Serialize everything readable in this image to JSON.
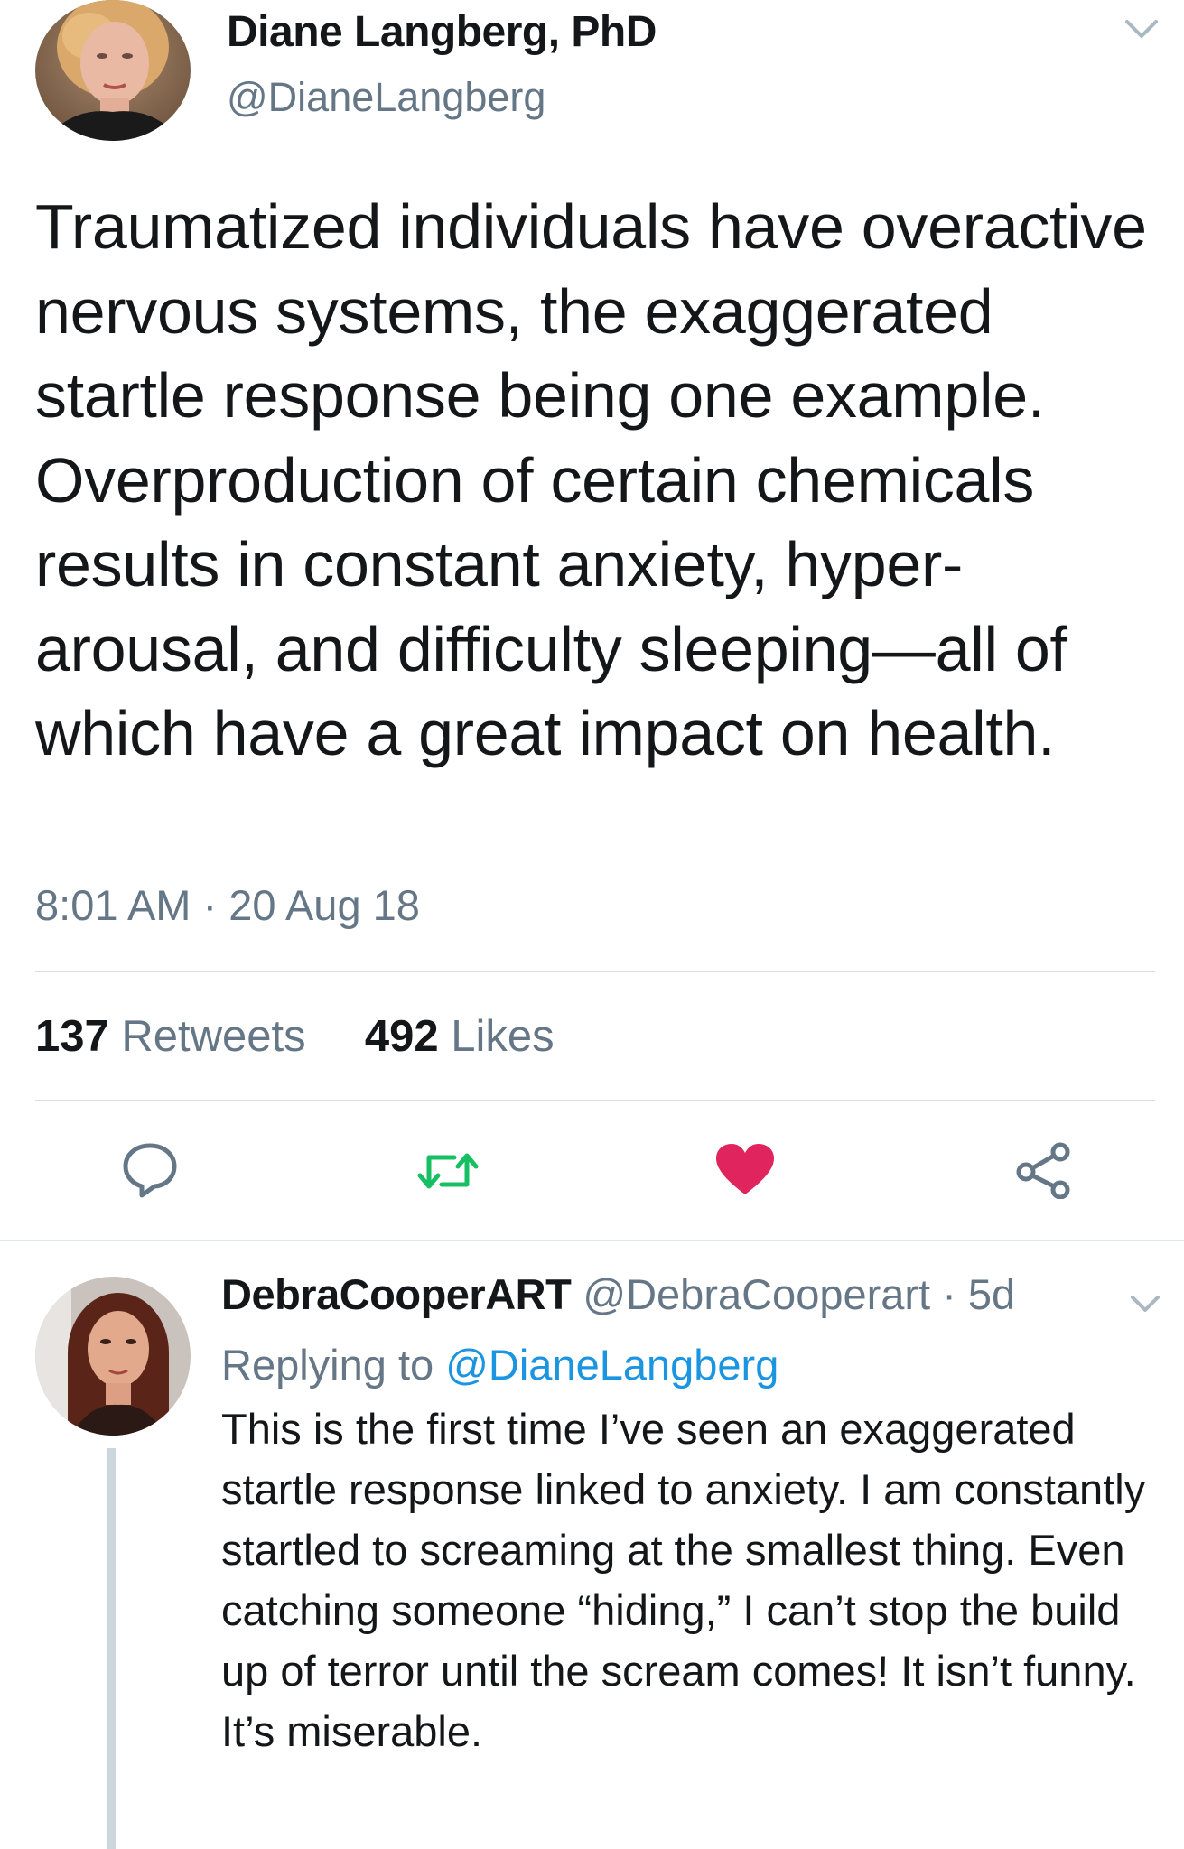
{
  "tweet": {
    "author_name": "Diane Langberg, PhD",
    "author_handle": "@DianeLangberg",
    "avatar_icon": "profile-photo-woman-blonde",
    "menu_icon": "chevron-down-icon",
    "text": "Traumatized individuals have overactive nervous systems, the exaggerated startle response being one example. Overproduction of certain chemicals results in constant anxiety, hyper-arousal, and difficulty sleeping—all of which have a great impact on health.",
    "timestamp": "8:01 AM · 20 Aug 18",
    "retweets_count": "137",
    "retweets_label": "Retweets",
    "likes_count": "492",
    "likes_label": "Likes",
    "actions": {
      "reply_icon": "reply-icon",
      "retweet_icon": "retweet-icon",
      "like_icon": "heart-icon",
      "share_icon": "share-icon"
    },
    "colors": {
      "retweet": "#17bf63",
      "like": "#e0245e",
      "secondary_text": "#657786",
      "link": "#1b95e0"
    }
  },
  "reply": {
    "author_name": "DebraCooperART",
    "author_handle": "@DebraCooperart",
    "separator": "·",
    "time": "5d",
    "avatar_icon": "profile-photo-woman-brunette",
    "replying_prefix": "Replying to",
    "replying_handle": "@DianeLangberg",
    "text": "This is the first time I’ve seen an exaggerated startle response linked to anxiety. I am constantly startled to screaming at the smallest thing. Even catching someone “hiding,” I can’t stop the build up of terror until the scream comes! It isn’t funny. It’s miserable."
  }
}
